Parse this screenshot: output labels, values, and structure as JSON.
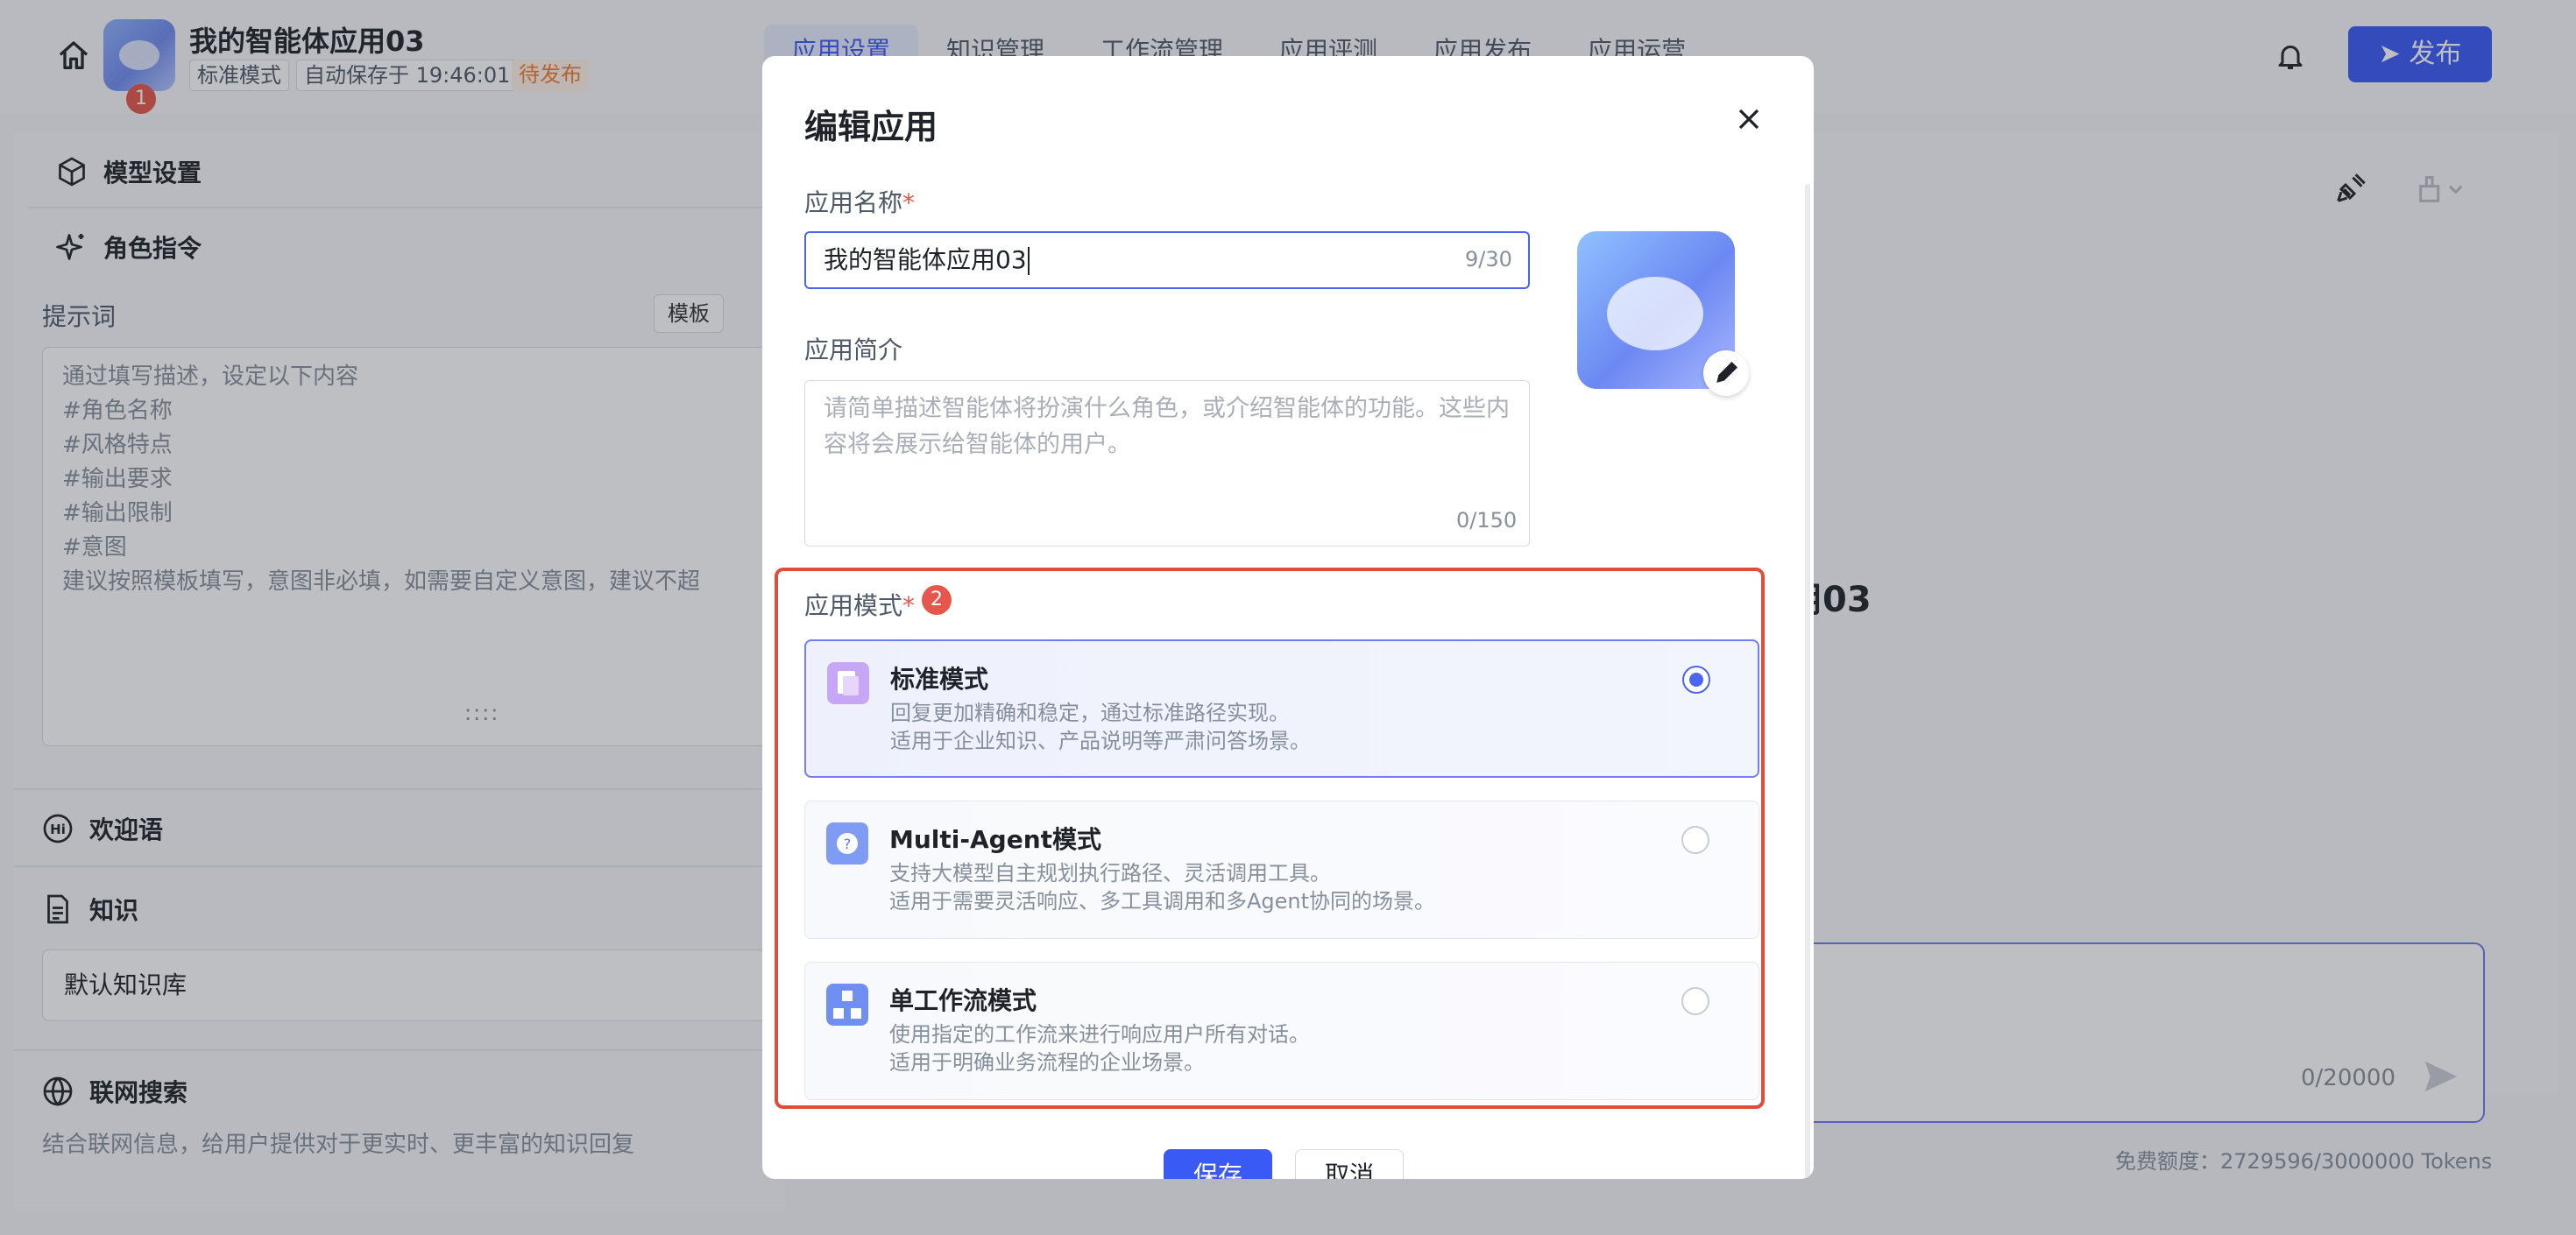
{
  "header": {
    "app_title": "我的智能体应用03",
    "tag_mode": "标准模式",
    "tag_autosave": "自动保存于 19:46:01",
    "tag_status": "待发布",
    "badge": "1",
    "tabs": [
      "应用设置",
      "知识管理",
      "工作流管理",
      "应用评测",
      "应用发布",
      "应用运营"
    ],
    "publish_label": "发布"
  },
  "left_panel": {
    "model_settings": "模型设置",
    "role_instructions": "角色指令",
    "prompt_label": "提示词",
    "template_button": "模板",
    "prompt_placeholder": "通过填写描述，设定以下内容\n#角色名称\n#风格特点\n#输出要求\n#输出限制\n#意图\n建议按照模板填写，意图非必填，如需要自定义意图，建议不超",
    "welcome": "欢迎语",
    "knowledge": "知识",
    "knowledge_base": "默认知识库",
    "web_search": "联网搜索",
    "web_search_desc": "结合联网信息，给用户提供对于更实时、更丰富的知识回复"
  },
  "preview": {
    "title_fragment": "用03",
    "input_count": "0/20000",
    "quota": "免费额度：2729596/3000000 Tokens"
  },
  "modal": {
    "title": "编辑应用",
    "name_label": "应用名称",
    "required_mark": "*",
    "name_value": "我的智能体应用03",
    "name_count": "9/30",
    "desc_label": "应用简介",
    "desc_placeholder": "请简单描述智能体将扮演什么角色，或介绍智能体的功能。这些内容将会展示给智能体的用户。",
    "desc_count": "0/150",
    "mode_label": "应用模式",
    "mode_badge": "2",
    "modes": [
      {
        "title": "标准模式",
        "desc1": "回复更加精确和稳定，通过标准路径实现。",
        "desc2": "适用于企业知识、产品说明等严肃问答场景。",
        "selected": true
      },
      {
        "title": "Multi-Agent模式",
        "desc1": "支持大模型自主规划执行路径、灵活调用工具。",
        "desc2": "适用于需要灵活响应、多工具调用和多Agent协同的场景。",
        "selected": false
      },
      {
        "title": "单工作流模式",
        "desc1": "使用指定的工作流来进行响应用户所有对话。",
        "desc2": "适用于明确业务流程的企业场景。",
        "selected": false
      }
    ],
    "save_label": "保存",
    "cancel_label": "取消"
  },
  "colors": {
    "primary": "#3a5af5",
    "highlight_frame": "#e24c3c",
    "badge": "#e7564a",
    "status_orange": "#f27c2e"
  }
}
